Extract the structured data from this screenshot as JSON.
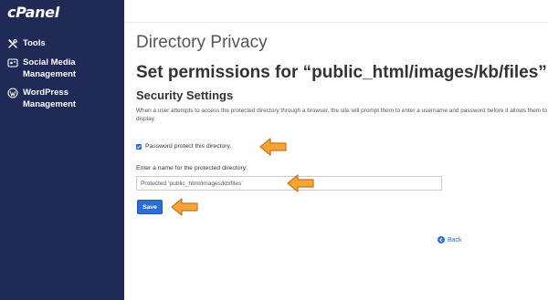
{
  "app": {
    "logo_text": "cPanel"
  },
  "sidebar": {
    "items": [
      {
        "label": "Tools",
        "icon": "tools-icon"
      },
      {
        "label": "Social Media Management",
        "icon": "social-media-icon"
      },
      {
        "label": "WordPress Management",
        "icon": "wordpress-icon"
      }
    ]
  },
  "main": {
    "page_title": "Directory Privacy",
    "perm_prefix": "Set permissions for “",
    "perm_path": "public_html/images/kb/files",
    "perm_suffix": "”.",
    "section_title": "Security Settings",
    "description": "When a user attempts to access the protected directory through a browser, the site will prompt them to enter a username and password before it allows them to display.",
    "checkbox_label": "Password protect this directory.",
    "checkbox_checked": true,
    "name_field_label": "Enter a name for the protected directory:",
    "name_field_value": "Protected ‘public_html/images/kb/files’",
    "save_label": "Save",
    "back_label": "Back"
  },
  "colors": {
    "sidebar_bg": "#1f2a57",
    "accent": "#2a6ed3",
    "arrow_fill": "#f7a434",
    "arrow_stroke": "#c9741a"
  }
}
